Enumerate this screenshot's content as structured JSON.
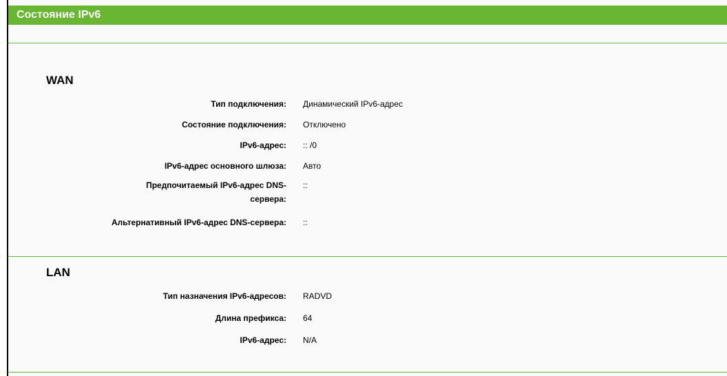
{
  "page_title": "Состояние IPv6",
  "wan": {
    "title": "WAN",
    "rows": [
      {
        "label": "Тип подключения:",
        "value": "Динамический IPv6-адрес"
      },
      {
        "label": "Состояние подключения:",
        "value": "Отключено"
      },
      {
        "label": "IPv6-адрес:",
        "value": ":: /0"
      },
      {
        "label": "IPv6-адрес основного шлюза:",
        "value": "Авто"
      },
      {
        "label_line1": "Предпочитаемый IPv6-адрес DNS-",
        "label_line2": "сервера:",
        "value": "::"
      },
      {
        "label": "Альтернативный IPv6-адрес DNS-сервера:",
        "value": "::"
      }
    ]
  },
  "lan": {
    "title": "LAN",
    "rows": [
      {
        "label": "Тип назначения IPv6-адресов:",
        "value": "RADVD"
      },
      {
        "label": "Длина префикса:",
        "value": "64"
      },
      {
        "label": "IPv6-адрес:",
        "value": "N/A"
      }
    ]
  },
  "colors": {
    "accent": "#68b631",
    "background": "#fafafa"
  }
}
